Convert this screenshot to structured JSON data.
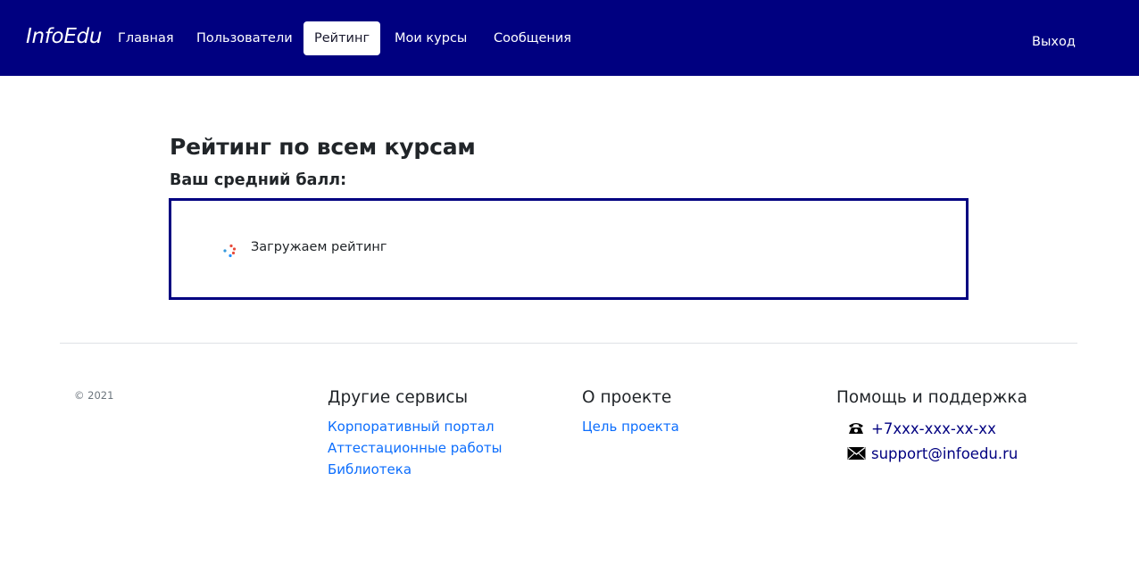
{
  "navbar": {
    "brand": "InfoEdu",
    "items": [
      {
        "label": "Главная"
      },
      {
        "label": "Пользователи"
      },
      {
        "label": "Рейтинг",
        "active": true
      },
      {
        "label": "Мои курсы"
      },
      {
        "label": "Сообщения"
      }
    ],
    "logout": "Выход",
    "background": "#000080"
  },
  "main": {
    "title": "Рейтинг по всем курсам",
    "subtitle": "Ваш средний балл:",
    "loading_text": "Загружаем рейтинг",
    "loading_icon": "spinner-icon",
    "box_border_color": "#000080"
  },
  "footer": {
    "copyright": "© 2021",
    "columns": [
      {
        "heading": "Другие сервисы",
        "links": [
          "Корпоративный портал",
          "Аттестационные работы",
          "Библиотека"
        ]
      },
      {
        "heading": "О проекте",
        "links": [
          "Цель проекта"
        ]
      },
      {
        "heading": "Помощь и поддержка",
        "contacts": [
          {
            "icon": "phone-icon",
            "text": "+7xxx-xxx-xx-xx"
          },
          {
            "icon": "envelope-icon",
            "text": "support@infoedu.ru"
          }
        ]
      }
    ],
    "link_color": "#0d6efd"
  }
}
